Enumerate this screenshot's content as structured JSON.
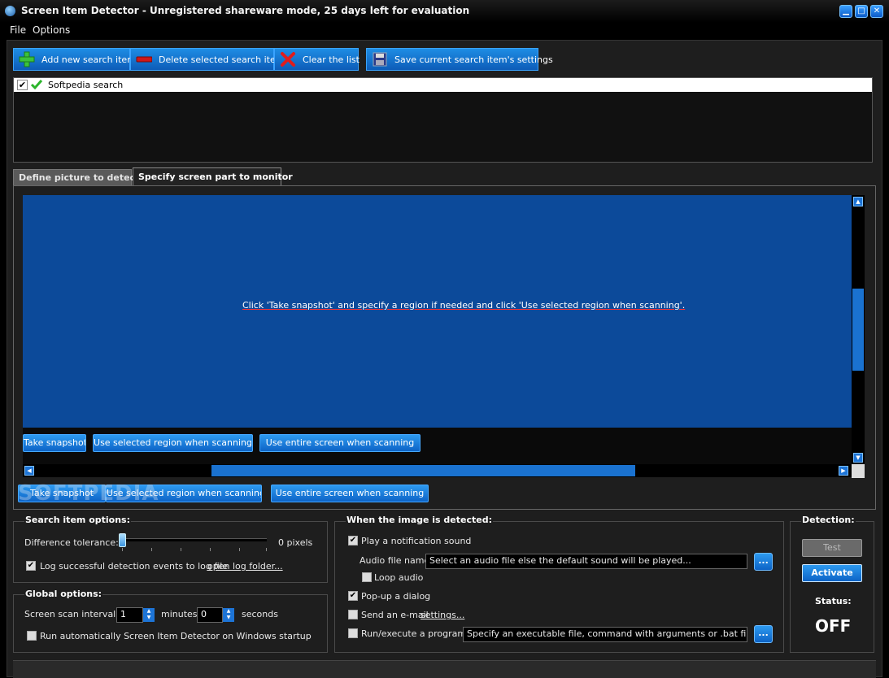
{
  "window": {
    "title": "Screen Item Detector - Unregistered shareware mode, 25 days left for evaluation",
    "minimize_glyph": "▁",
    "maximize_glyph": "□",
    "close_glyph": "✕"
  },
  "menu": {
    "file": "File",
    "options": "Options"
  },
  "toolbar": {
    "add": "Add new search item",
    "delete": "Delete selected search item",
    "clear": "Clear the list",
    "save": "Save current search item's settings"
  },
  "search_list": {
    "items": [
      {
        "label": "Softpedia search",
        "checked": true
      }
    ]
  },
  "tabs": {
    "define": "Define picture to detect",
    "specify": "Specify screen part to monitor"
  },
  "preview": {
    "message": "Click 'Take snapshot' and specify a region if needed and click 'Use selected region when scanning'.",
    "inner_buttons": {
      "snapshot": "Take snapshot",
      "selected": "Use selected region when scanning",
      "entire": "Use entire screen when scanning"
    },
    "scroll_up": "▲",
    "scroll_down": "▼",
    "scroll_left": "◀",
    "scroll_right": "▶"
  },
  "panel_buttons": {
    "snapshot": "Take snapshot",
    "selected": "Use selected region when scanning",
    "entire": "Use entire screen when scanning"
  },
  "watermark": "SOFTPEDIA",
  "search_options": {
    "title": "Search item options:",
    "tolerance_label": "Difference tolerance:",
    "tolerance_value": "0 pixels",
    "log_label": "Log successful detection events to log file",
    "log_checked": true,
    "log_link": "open log folder..."
  },
  "global_options": {
    "title": "Global options:",
    "interval_label": "Screen scan interval:",
    "minutes_value": "1",
    "minutes_label": "minutes",
    "seconds_value": "0",
    "seconds_label": "seconds",
    "startup_label": "Run automatically Screen Item Detector on Windows startup",
    "startup_checked": false
  },
  "on_detect": {
    "title": "When the image is detected:",
    "sound_label": "Play a notification sound",
    "sound_checked": true,
    "audio_label": "Audio file name:",
    "audio_value": "Select an audio file else the default sound will be played...",
    "browse": "...",
    "loop_label": "Loop audio",
    "loop_checked": false,
    "dialog_label": "Pop-up a dialog",
    "dialog_checked": true,
    "email_label": "Send an e-mail",
    "email_link": "settings...",
    "email_checked": false,
    "run_label": "Run/execute a program:",
    "run_value": "Specify an executable file, command with arguments or .bat file...",
    "run_checked": false
  },
  "detection": {
    "title": "Detection:",
    "test": "Test",
    "activate": "Activate",
    "status_label": "Status:",
    "status_value": "OFF"
  },
  "colors": {
    "accent": "#1a72d0",
    "preview_bg": "#0c4a9a",
    "background": "#1e1e1e"
  }
}
